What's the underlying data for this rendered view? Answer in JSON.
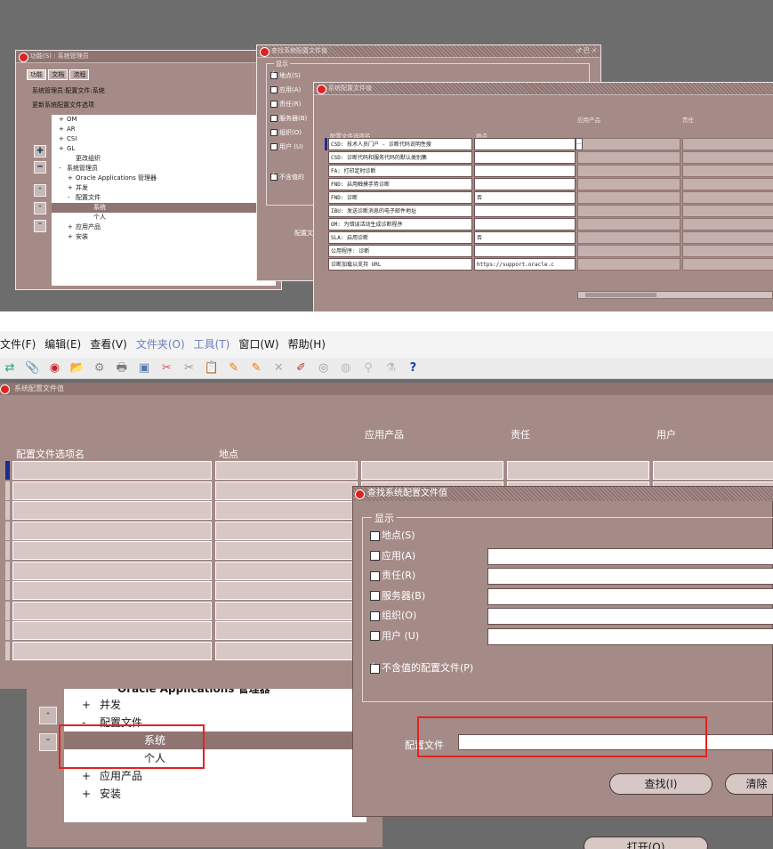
{
  "top": {
    "left_window": {
      "title": "功能(S) : 系统管理员",
      "tabs": [
        "功能",
        "文档",
        "流程"
      ],
      "line1": "系统管理员:配置文件:系统",
      "line2": "更新系统配置文件选项",
      "tree": [
        {
          "sign": "+",
          "label": "OM",
          "indent": 0
        },
        {
          "sign": "+",
          "label": "AR",
          "indent": 0
        },
        {
          "sign": "+",
          "label": "CSI",
          "indent": 0
        },
        {
          "sign": "+",
          "label": "GL",
          "indent": 0
        },
        {
          "sign": "",
          "label": "更改组织",
          "indent": 1
        },
        {
          "sign": "-",
          "label": "系统管理员",
          "indent": 0
        },
        {
          "sign": "+",
          "label": "Oracle Applications 管理器",
          "indent": 1
        },
        {
          "sign": "+",
          "label": "并发",
          "indent": 1
        },
        {
          "sign": "-",
          "label": "配置文件",
          "indent": 1
        },
        {
          "sign": "",
          "label": "系统",
          "indent": 3,
          "selected": true
        },
        {
          "sign": "",
          "label": "个人",
          "indent": 3
        },
        {
          "sign": "+",
          "label": "应用产品",
          "indent": 1
        },
        {
          "sign": "+",
          "label": "安装",
          "indent": 1
        }
      ]
    },
    "find_window": {
      "title": "查找系统配置文件值",
      "controls": "♂ 巴 ✕",
      "group": "显示",
      "checks": [
        {
          "label": "地点(S)",
          "on": true
        },
        {
          "label": "应用(A)",
          "on": false
        },
        {
          "label": "责任(R)",
          "on": false
        },
        {
          "label": "服务器(B)",
          "on": false
        },
        {
          "label": "组织(O)",
          "on": false
        },
        {
          "label": "用户 (U)",
          "on": false
        }
      ],
      "no_value": "不含值的",
      "profile_label": "配置文"
    },
    "values_window": {
      "title": "系统配置文件值",
      "col_name": "配置文件选项名",
      "col_site": "地点",
      "col_app": "应用产品",
      "col_resp": "责任",
      "rows": [
        {
          "name": "CSD: 技术人员门户 - 诊断代码说明性搜",
          "site": ""
        },
        {
          "name": "CSD: 诊断代码和服务代码的默认类别集",
          "site": ""
        },
        {
          "name": "FA: 打印定时诊断",
          "site": ""
        },
        {
          "name": "FND: 启用触摸手势诊断",
          "site": ""
        },
        {
          "name": "FND: 诊断",
          "site": "否"
        },
        {
          "name": "IBU: 发送诊断消息的电子邮件地址",
          "site": ""
        },
        {
          "name": "OM: 为错误活动生成诊断程序",
          "site": ""
        },
        {
          "name": "SLA: 启用诊断",
          "site": "否"
        },
        {
          "name": "公用程序: 诊断",
          "site": ""
        },
        {
          "name": "诊断加载以支持 URL",
          "site": "https://support.oracle.c"
        }
      ],
      "ellipsis": "..."
    }
  },
  "bottom": {
    "menu": [
      "文件(F)",
      "编辑(E)",
      "查看(V)",
      "文件夹(O)",
      "工具(T)",
      "窗口(W)",
      "帮助(H)"
    ],
    "help_icon": "?",
    "values_window": {
      "title": "系统配置文件值",
      "col_name": "配置文件选项名",
      "col_site": "地点",
      "col_app": "应用产品",
      "col_resp": "责任",
      "col_user": "用户"
    },
    "tree_partial": [
      {
        "sign": "",
        "label": "Oracle Applications 管理器"
      },
      {
        "sign": "+",
        "label": "并发"
      },
      {
        "sign": "-",
        "label": "配置文件"
      },
      {
        "sign": "",
        "label": "系统",
        "selected": true
      },
      {
        "sign": "",
        "label": "个人"
      },
      {
        "sign": "+",
        "label": "应用产品"
      },
      {
        "sign": "+",
        "label": "安装"
      }
    ],
    "find_window": {
      "title": "查找系统配置文件值",
      "group": "显示",
      "checks": [
        {
          "label": "地点(S)",
          "on": true
        },
        {
          "label": "应用(A)",
          "on": false
        },
        {
          "label": "责任(R)",
          "on": false
        },
        {
          "label": "服务器(B)",
          "on": false
        },
        {
          "label": "组织(O)",
          "on": false
        },
        {
          "label": "用户 (U)",
          "on": false
        }
      ],
      "no_value_check": {
        "label": "不含值的配置文件(P)",
        "on": true
      },
      "profile_label": "配置文件",
      "profile_value": "",
      "find_button": "查找(I)",
      "clear_button": "清除",
      "bottom_button": "打开(O)"
    }
  },
  "colors": {
    "frame": "#a58b87",
    "titlebar": "#8f7471",
    "highlight_red": "#e8201f"
  }
}
